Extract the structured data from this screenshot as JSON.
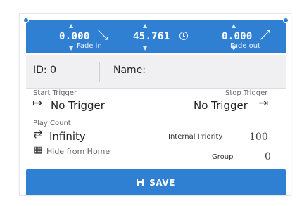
{
  "header": {
    "fade_in": {
      "value": "0.000",
      "label": "Fade in"
    },
    "duration": {
      "value": "45.761"
    },
    "fade_out": {
      "value": "0.000",
      "label": "Fade out"
    }
  },
  "id_row": {
    "id_label": "ID: 0",
    "name_label": "Name:"
  },
  "start_trigger": {
    "label": "Start Trigger",
    "value": "No Trigger"
  },
  "stop_trigger": {
    "label": "Stop Trigger",
    "value": "No Trigger"
  },
  "play_count": {
    "label": "Play Count",
    "value": "Infinity"
  },
  "hide_from_home": {
    "label": "Hide from Home"
  },
  "internal_priority": {
    "label": "Internal Priority",
    "value": "100"
  },
  "group": {
    "label": "Group",
    "value": "0"
  },
  "save": {
    "label": "SAVE"
  },
  "colors": {
    "accent": "#2f7fd3",
    "row_bg": "#f0f0f2"
  },
  "icons": {
    "start": "arrow-right-to-bar-icon",
    "stop": "arrow-right-to-bar-icon",
    "loop": "repeat-icon",
    "hide": "calendar-gear-icon",
    "fade_in": "diagonal-up-arrow-icon",
    "duration": "clock-icon",
    "fade_out": "diagonal-down-arrow-icon",
    "save": "floppy-disk-icon"
  }
}
